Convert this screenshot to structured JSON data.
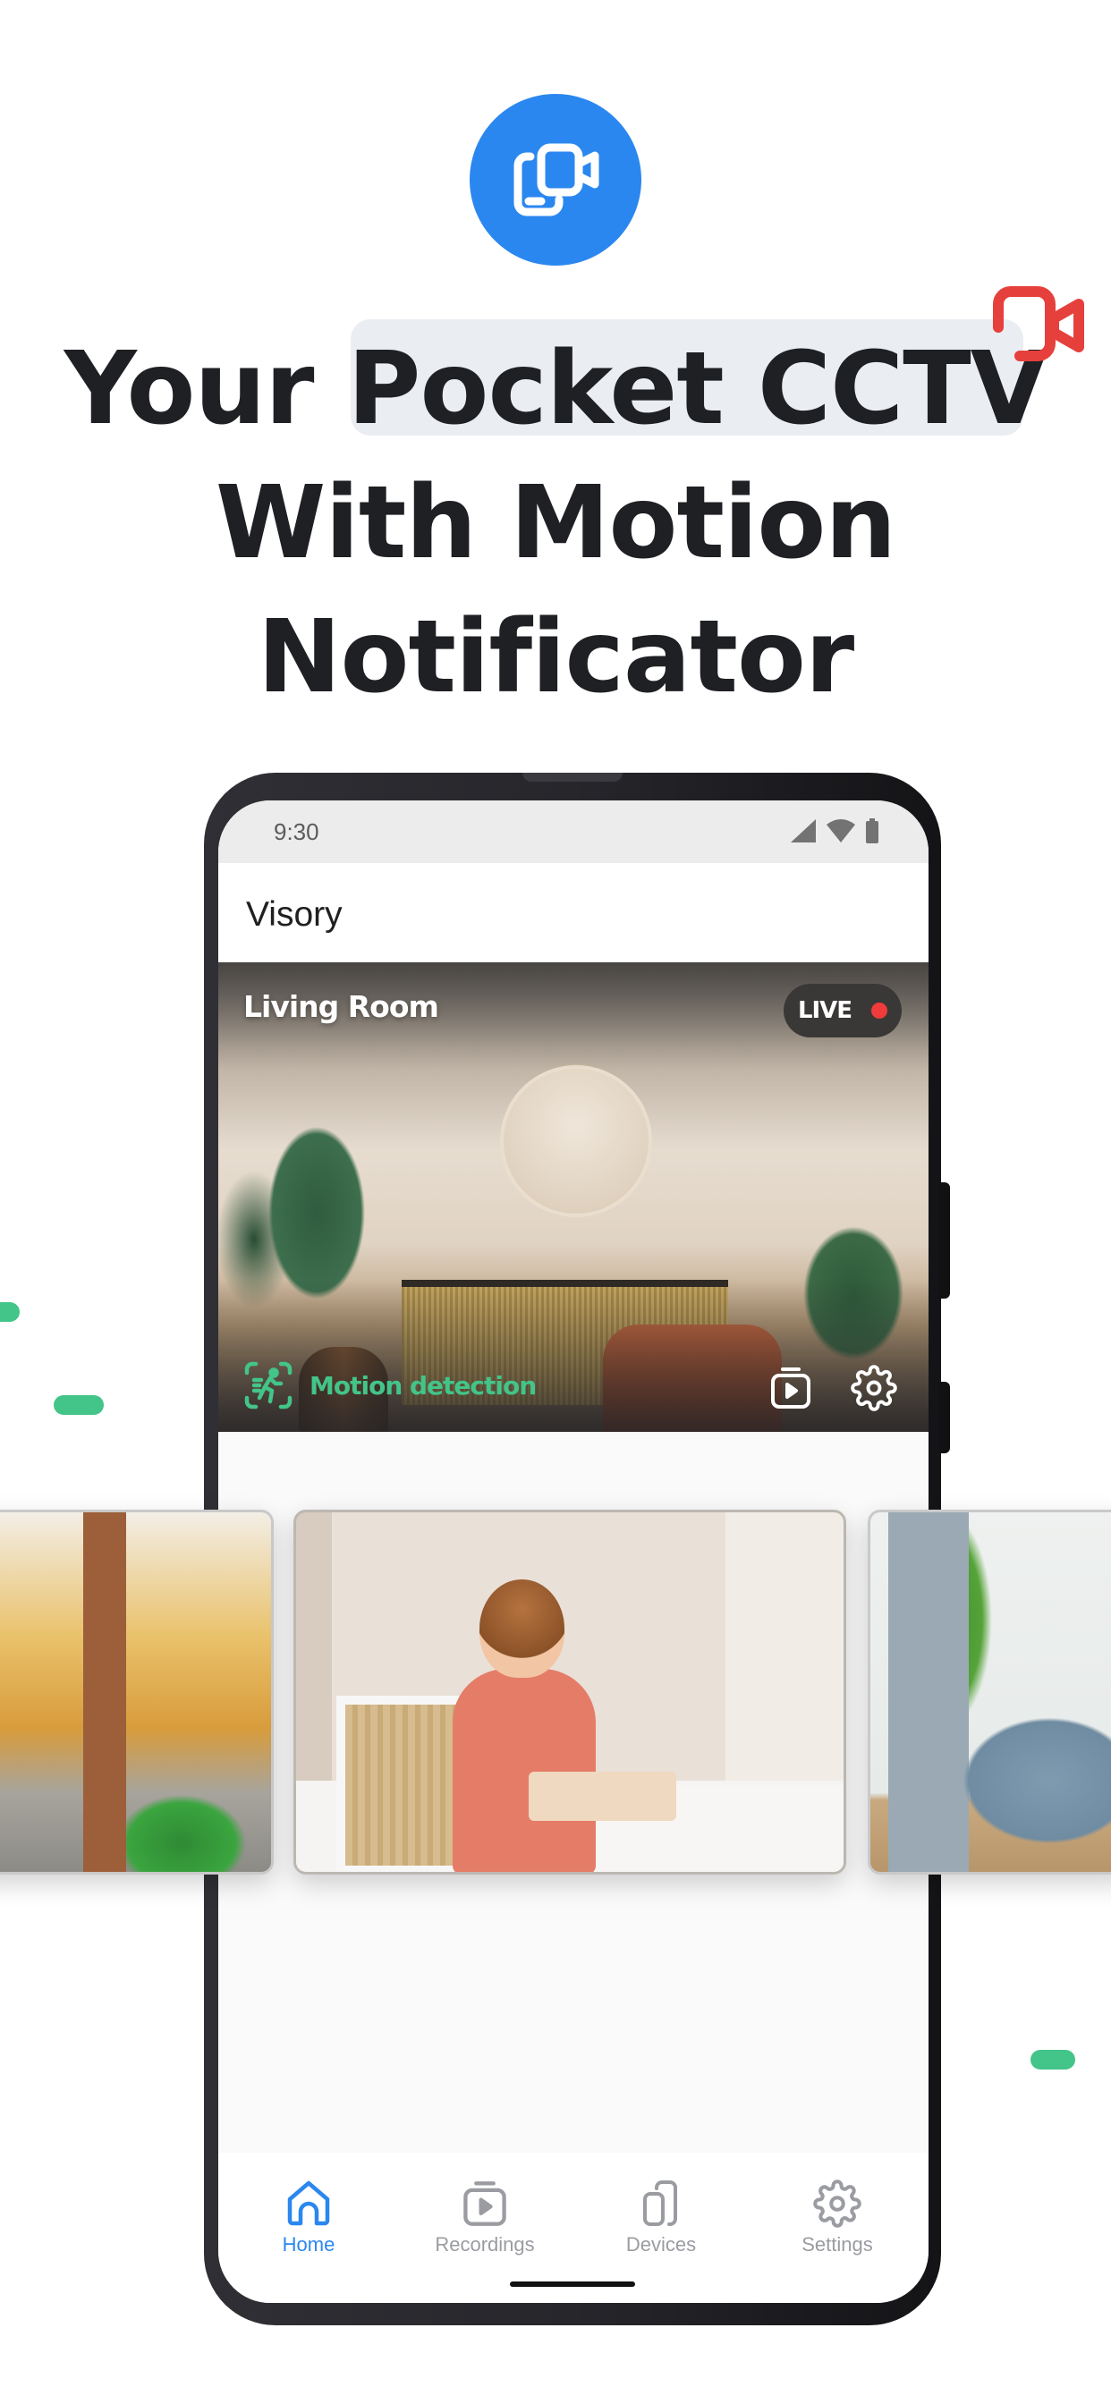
{
  "promo": {
    "headline_lines": [
      "Your Pocket CCTV",
      "With Motion",
      "Notificator"
    ],
    "brand_color": "#2b87f0",
    "accent_red": "#e6403c",
    "accent_green": "#43c488",
    "logo_icon": "phone-camera-icon",
    "decoration_icon": "video-camera-icon"
  },
  "status_bar": {
    "time": "9:30",
    "icons": [
      "signal-icon",
      "wifi-icon",
      "battery-icon"
    ]
  },
  "app": {
    "title": "Visory"
  },
  "live_feed": {
    "camera_name": "Living Room",
    "live_label": "LIVE",
    "motion_label": "Motion detection",
    "motion_icon": "motion-detection-icon",
    "actions": [
      {
        "name": "recordings",
        "icon": "recordings-icon"
      },
      {
        "name": "settings",
        "icon": "gear-icon"
      }
    ]
  },
  "carousel": {
    "cards": [
      {
        "scene": "Courtyard with arches and potted plants"
      },
      {
        "scene": "Child playing at a table in a playroom"
      },
      {
        "scene": "Palm plant beside a blue pet bed"
      }
    ]
  },
  "bottom_nav": {
    "items": [
      {
        "label": "Home",
        "icon": "home-icon",
        "active": true
      },
      {
        "label": "Recordings",
        "icon": "recordings-icon",
        "active": false
      },
      {
        "label": "Devices",
        "icon": "devices-icon",
        "active": false
      },
      {
        "label": "Settings",
        "icon": "gear-icon",
        "active": false
      }
    ]
  }
}
